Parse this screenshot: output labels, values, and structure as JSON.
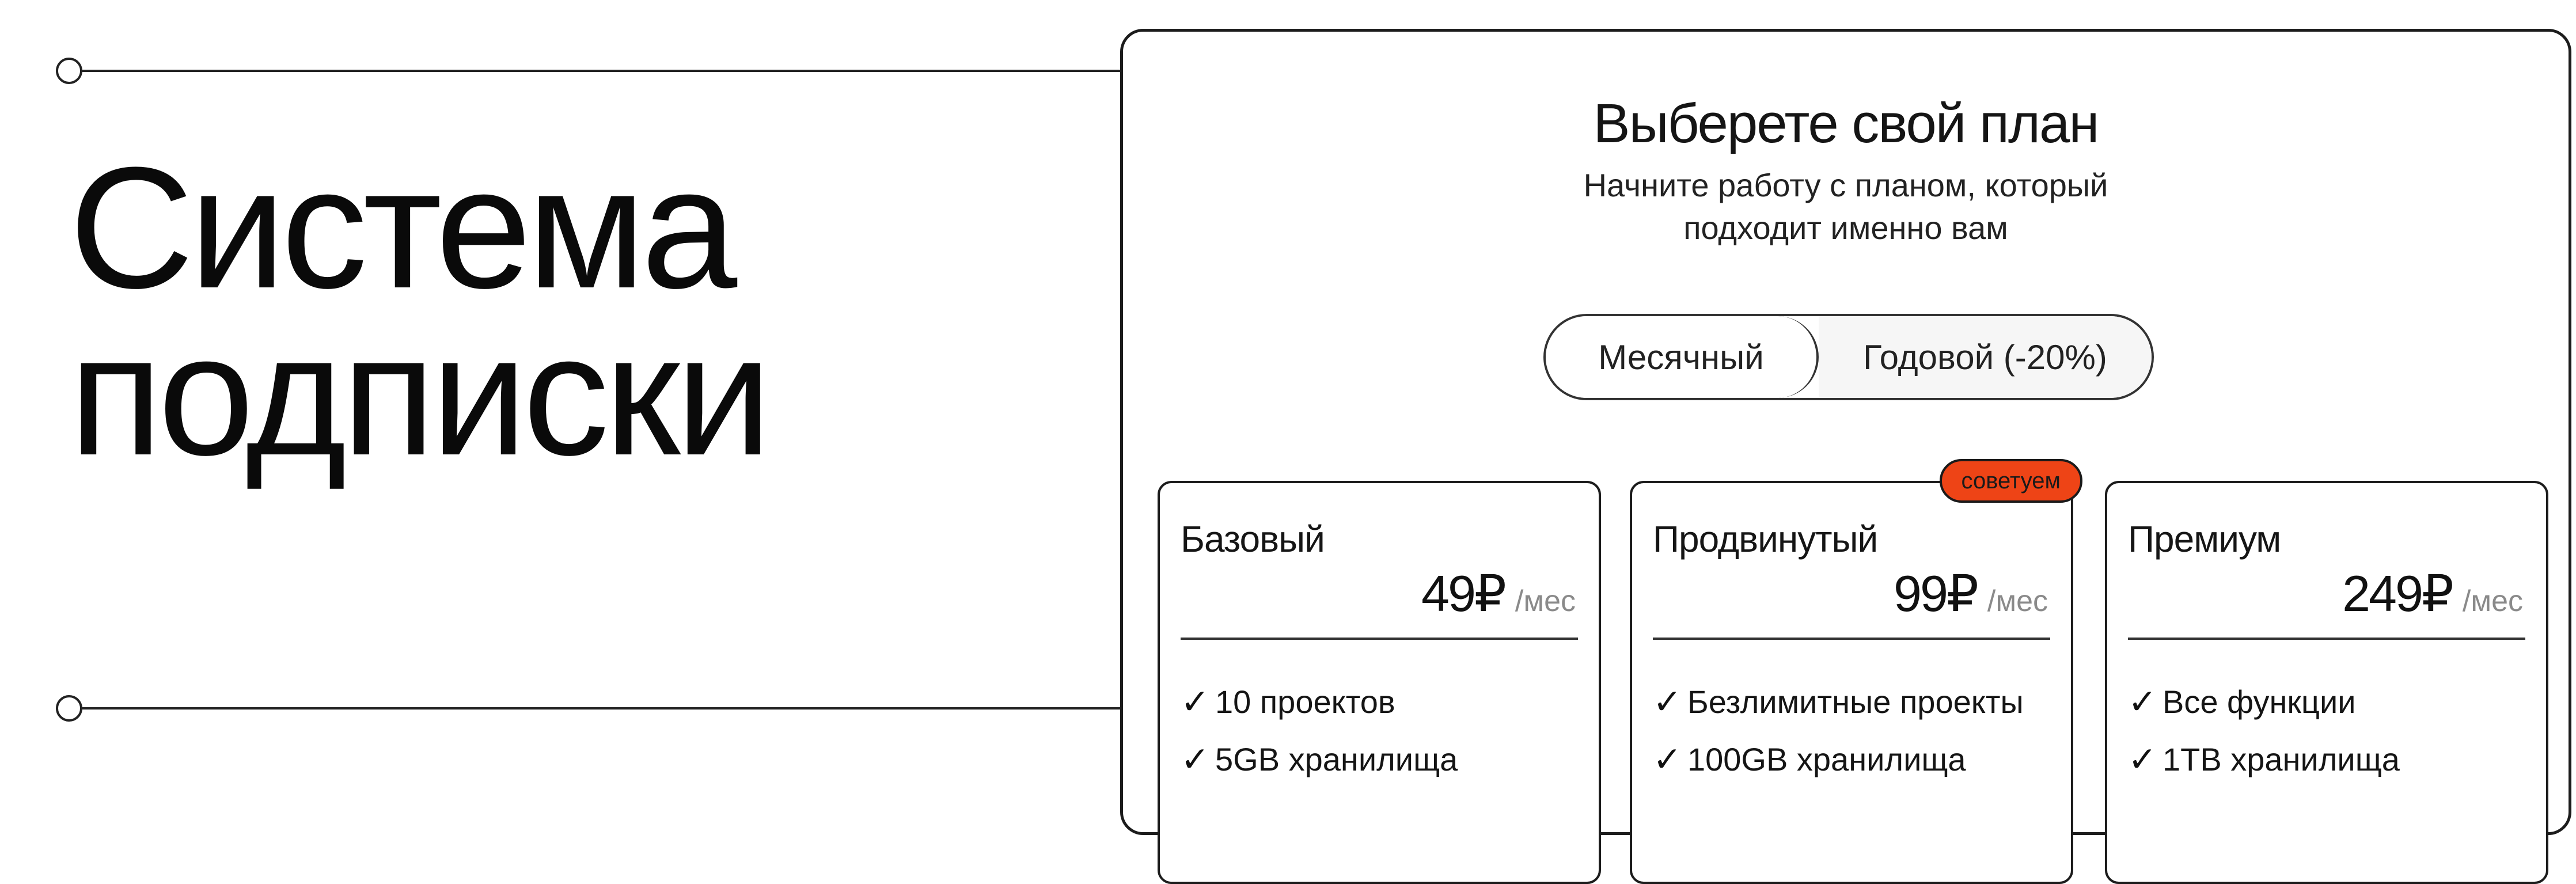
{
  "hero": {
    "title_line1": "Система",
    "title_line2": "подписки"
  },
  "pricing": {
    "title": "Выберете свой план",
    "subtitle_line1": "Начните работу с планом, который",
    "subtitle_line2": "подходит именно вам",
    "toggle": {
      "monthly_label": "Месячный",
      "yearly_label": "Годовой (-20%)"
    },
    "plans": [
      {
        "name": "Базовый",
        "price": "49₽",
        "period": "/мес",
        "features": [
          "10 проектов",
          "5GB хранилища"
        ]
      },
      {
        "name": "Продвинутый",
        "price": "99₽",
        "period": "/мес",
        "badge": "советуем",
        "features": [
          "Безлимитные проекты",
          "100GB хранилища"
        ]
      },
      {
        "name": "Премиум",
        "price": "249₽",
        "period": "/мес",
        "features": [
          "Все функции",
          "1TB хранилища"
        ]
      }
    ],
    "check_symbol": "✓"
  },
  "colors": {
    "accent_badge": "#ee4416",
    "ink": "#111111",
    "muted": "#8a8a8a"
  }
}
